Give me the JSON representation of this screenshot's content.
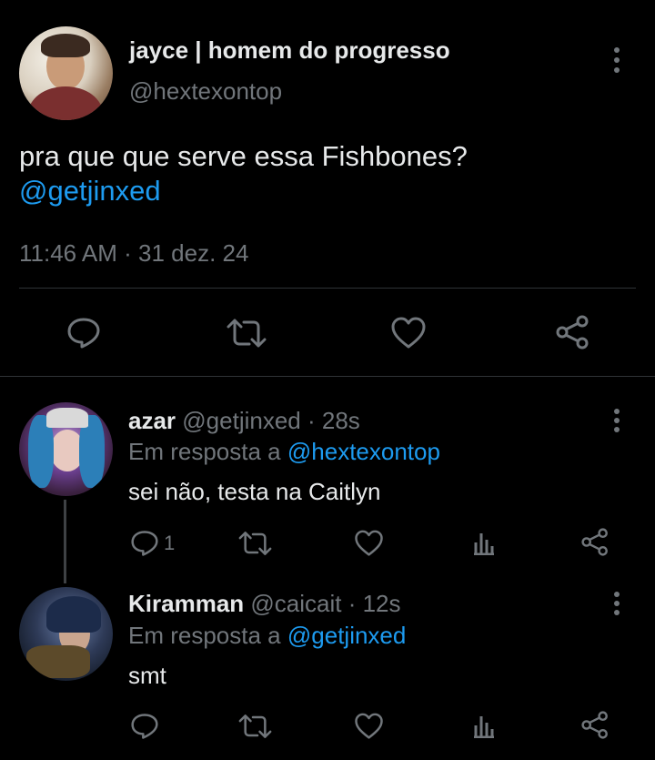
{
  "main_tweet": {
    "display_name": "jayce | homem do progresso",
    "handle": "@hextexontop",
    "text": "pra que que serve essa Fishbones?",
    "mention": "@getjinxed",
    "timestamp": "11:46 AM · 31 dez. 24"
  },
  "replies": [
    {
      "display_name": "azar",
      "handle": "@getjinxed",
      "time": "· 28s",
      "in_reply_prefix": "Em resposta a",
      "in_reply_to": "@hextexontop",
      "text": "sei não, testa na Caitlyn",
      "reply_count": "1"
    },
    {
      "display_name": "Kiramman",
      "handle": "@caicait",
      "time": "· 12s",
      "in_reply_prefix": "Em resposta a",
      "in_reply_to": "@getjinxed",
      "text": "smt",
      "reply_count": ""
    }
  ],
  "colors": {
    "background": "#000000",
    "text": "#e7e9ea",
    "muted": "#71767b",
    "link": "#1d9bf0",
    "divider": "#2f3336"
  },
  "icons": [
    "reply-icon",
    "retweet-icon",
    "like-icon",
    "share-icon",
    "views-icon",
    "more-icon"
  ]
}
